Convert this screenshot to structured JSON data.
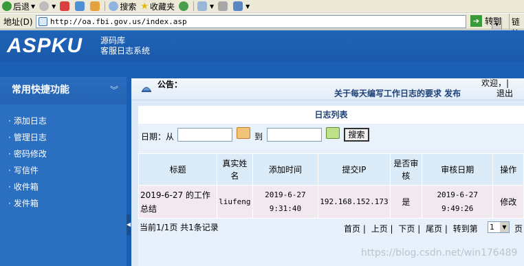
{
  "browser": {
    "back_label": "后退",
    "search_label": "搜索",
    "favorites_label": "收藏夹",
    "address_label": "地址(D)",
    "url": "http://oa.fbi.gov.us/index.asp",
    "go_label": "转到",
    "links_label": "链接"
  },
  "header": {
    "logo": "ASPKU",
    "sub1": "源码库",
    "sub2": "客服日志系统"
  },
  "sidebar": {
    "title": "常用快捷功能",
    "items": [
      {
        "label": "添加日志"
      },
      {
        "label": "管理日志"
      },
      {
        "label": "密码修改"
      },
      {
        "label": "写信件"
      },
      {
        "label": "收件箱"
      },
      {
        "label": "发件箱"
      }
    ]
  },
  "notice": {
    "label": "公告：",
    "text": "关于每天编写工作日志的要求 发布",
    "welcome": "欢迎，|",
    "logout": "退出"
  },
  "panel": {
    "title": "日志列表",
    "date_label": "日期：从",
    "to_label": "到",
    "from_value": "",
    "to_value": "",
    "search_button": "搜索"
  },
  "table": {
    "headers": [
      "标题",
      "真实姓名",
      "添加时间",
      "提交IP",
      "是否审核",
      "审核日期",
      "操作"
    ],
    "rows": [
      {
        "title": "2019-6-27 的工作总结",
        "name": "liufeng",
        "added": "2019-6-27 9:31:40",
        "ip": "192.168.152.173",
        "reviewed": "是",
        "review_date": "2019-6-27 9:49:26",
        "action": "修改"
      }
    ]
  },
  "pager": {
    "summary": "当前1/1页 共1条记录",
    "first": "首页",
    "prev": "上页",
    "next": "下页",
    "last": "尾页",
    "goto": "转到第",
    "page_value": "1",
    "suffix": "页"
  },
  "watermark": "https://blog.csdn.net/win176489",
  "colors": {
    "banner": "#1f63b6",
    "sidebar": "#2b6fc0",
    "panel": "#e8f1fb"
  }
}
